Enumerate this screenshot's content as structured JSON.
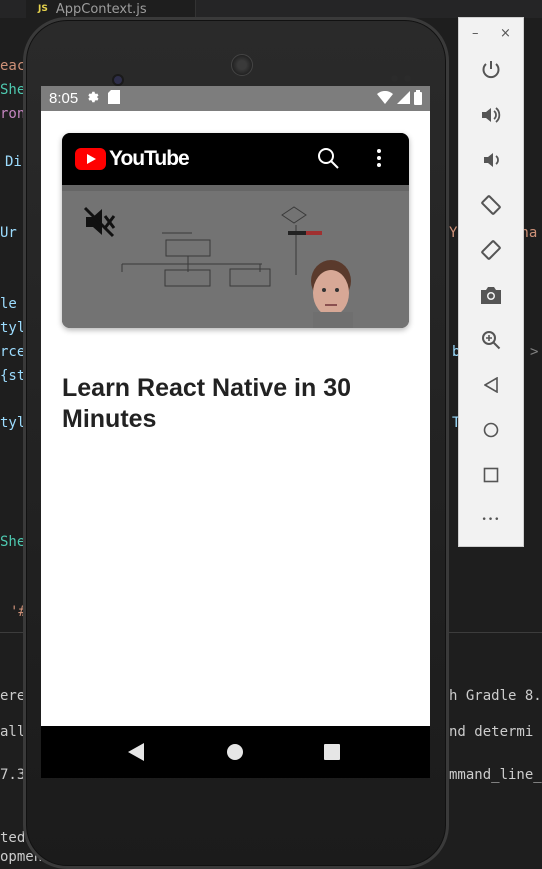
{
  "editor": {
    "tab_icon": "JS",
    "tab_name": "AppContext.js",
    "left_fragments": [
      "eac",
      "She",
      "ron",
      "Di",
      "Ur",
      "le",
      "tyl",
      "rce",
      "{st",
      "tyl",
      "She",
      "'#"
    ],
    "right_fragments": [
      "Y",
      "cha",
      "b",
      ">",
      "T"
    ],
    "terminal_lines": [
      {
        "left": "ere",
        "right": "h Gradle 8."
      },
      {
        "left": "all",
        "right": "nd determi"
      },
      {
        "left": "7.3",
        "right": "mmand_line_"
      },
      {
        "left": "ted,",
        "right": ""
      },
      {
        "left": "opment se",
        "right": ""
      }
    ]
  },
  "emulator": {
    "minimize_label": "–",
    "close_label": "×",
    "tools": [
      "power-icon",
      "volume-up-icon",
      "volume-down-icon",
      "rotate-left-icon",
      "rotate-right-icon",
      "camera-icon",
      "zoom-icon",
      "back-icon",
      "home-icon",
      "overview-icon",
      "more-icon"
    ],
    "more_label": "•••"
  },
  "phone": {
    "status": {
      "time": "8:05"
    },
    "video": {
      "brand": "YouTube"
    },
    "title": "Learn React Native in 30 Minutes"
  },
  "colors": {
    "status_bar": "#7d7d7d",
    "youtube_red": "#ff0000",
    "editor_bg": "#1e1e1e"
  }
}
